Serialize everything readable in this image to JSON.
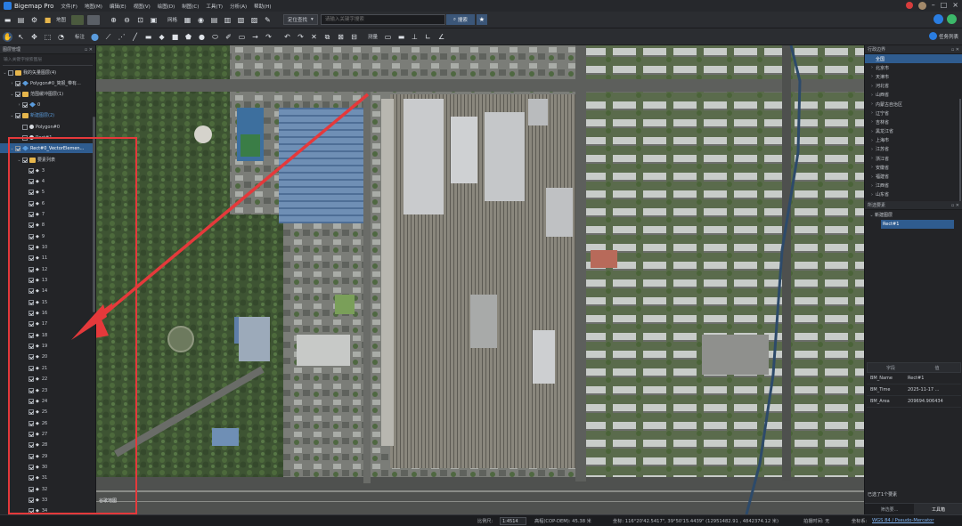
{
  "app": {
    "title": "Bigemap Pro"
  },
  "menu": [
    "文件(F)",
    "地图(M)",
    "编辑(E)",
    "视图(V)",
    "绘图(D)",
    "制图(C)",
    "工具(T)",
    "分析(A)",
    "帮助(H)"
  ],
  "toolbar1": {
    "map_label": "地图",
    "grid_label": "网格",
    "locate_button": "定位查找",
    "search_placeholder": "请输入关键字搜索",
    "search_button": "搜索"
  },
  "toolbar2": {
    "tag_label": "标注",
    "measure_label": "测量",
    "task_list": "任务列表"
  },
  "layers_panel": {
    "title": "图层管理",
    "search_placeholder": "输入关键字搜索图层",
    "root": "我的矢量图层(4)",
    "polygon_item": "Polygon#0_简报_带有...",
    "circle_folder": "范围缓冲图层(1)",
    "circle_item": "0",
    "draw_folder": "新建图层(2)",
    "polygon0": "Polygon#0",
    "rect_item": "Rect#1",
    "vector_item": "Rect#0_VectorElemen...",
    "sub_folder": "要素列表",
    "numbers": [
      "3",
      "4",
      "5",
      "6",
      "7",
      "8",
      "9",
      "10",
      "11",
      "12",
      "13",
      "14",
      "15",
      "16",
      "17",
      "18",
      "19",
      "20",
      "21",
      "22",
      "23",
      "24",
      "25",
      "26",
      "27",
      "28",
      "29",
      "30",
      "31",
      "32",
      "33",
      "34"
    ]
  },
  "region_panel": {
    "title": "行政边界",
    "items": [
      "全国",
      "北京市",
      "天津市",
      "河北省",
      "山西省",
      "内蒙古自治区",
      "辽宁省",
      "吉林省",
      "黑龙江省",
      "上海市",
      "江苏省",
      "浙江省",
      "安徽省",
      "福建省",
      "江西省",
      "山东省"
    ]
  },
  "feature_panel": {
    "title": "所选要素",
    "group": "新建图层",
    "item": "Rect#1"
  },
  "attributes": {
    "col_field": "字段",
    "col_value": "值",
    "rows": [
      {
        "key": "BM_Name",
        "value": "Rect#1"
      },
      {
        "key": "BM_Time",
        "value": "2025-11-17 ..."
      },
      {
        "key": "BM_Area",
        "value": "209694.906434"
      }
    ]
  },
  "right_status": "已选了1个要素",
  "right_tabs": [
    "筛选要...",
    "工具箱"
  ],
  "status": {
    "scale_label": "比例尺:",
    "scale_value": "1:4514",
    "elevation": "高程(COP-DEM): 45.38 米",
    "coords": "坐标: 116°20'42.5417\", 39°50'15.4439\"  (12951482.91 , 4842374.12 米)",
    "shot_time": "拍摄时间: 无",
    "crs_label": "坐标系:",
    "crs_value": "WGS 84 / Pseudo-Mercator"
  },
  "map": {
    "attribution": "谷歌地图"
  },
  "colors": {
    "accent": "#2f5c8f",
    "annotation_red": "#e5393b",
    "link": "#7fb3f0"
  }
}
